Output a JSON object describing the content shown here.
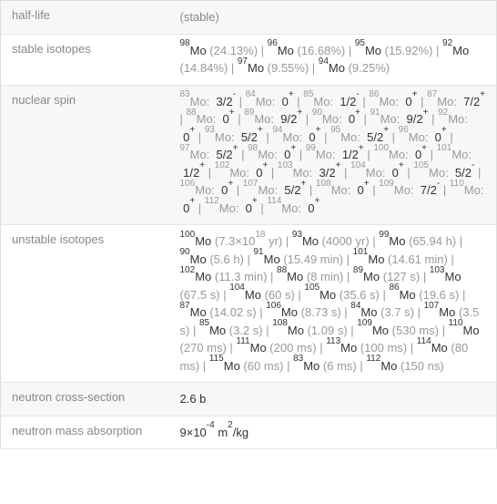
{
  "rows": [
    {
      "label": "half-life",
      "value": "(stable)",
      "type": "plain-grey"
    },
    {
      "label": "stable isotopes",
      "type": "iso-abundance",
      "items": [
        {
          "sup": "98",
          "el": "Mo",
          "abund": "(24.13%)"
        },
        {
          "sup": "96",
          "el": "Mo",
          "abund": "(16.68%)"
        },
        {
          "sup": "95",
          "el": "Mo",
          "abund": "(15.92%)"
        },
        {
          "sup": "92",
          "el": "Mo",
          "abund": "(14.84%)"
        },
        {
          "sup": "97",
          "el": "Mo",
          "abund": "(9.55%)"
        },
        {
          "sup": "94",
          "el": "Mo",
          "abund": "(9.25%)"
        }
      ]
    },
    {
      "label": "nuclear spin",
      "type": "nuclear-spin",
      "items": [
        {
          "sup": "83",
          "el": "Mo",
          "spin": "3/2",
          "sign": "-"
        },
        {
          "sup": "84",
          "el": "Mo",
          "spin": "0",
          "sign": "+"
        },
        {
          "sup": "85",
          "el": "Mo",
          "spin": "1/2",
          "sign": "-"
        },
        {
          "sup": "86",
          "el": "Mo",
          "spin": "0",
          "sign": "+"
        },
        {
          "sup": "87",
          "el": "Mo",
          "spin": "7/2",
          "sign": "+"
        },
        {
          "sup": "88",
          "el": "Mo",
          "spin": "0",
          "sign": "+"
        },
        {
          "sup": "89",
          "el": "Mo",
          "spin": "9/2",
          "sign": "+"
        },
        {
          "sup": "90",
          "el": "Mo",
          "spin": "0",
          "sign": "+"
        },
        {
          "sup": "91",
          "el": "Mo",
          "spin": "9/2",
          "sign": "+"
        },
        {
          "sup": "92",
          "el": "Mo",
          "spin": "0",
          "sign": "+"
        },
        {
          "sup": "93",
          "el": "Mo",
          "spin": "5/2",
          "sign": "+"
        },
        {
          "sup": "94",
          "el": "Mo",
          "spin": "0",
          "sign": "+"
        },
        {
          "sup": "95",
          "el": "Mo",
          "spin": "5/2",
          "sign": "+"
        },
        {
          "sup": "96",
          "el": "Mo",
          "spin": "0",
          "sign": "+"
        },
        {
          "sup": "97",
          "el": "Mo",
          "spin": "5/2",
          "sign": "+"
        },
        {
          "sup": "98",
          "el": "Mo",
          "spin": "0",
          "sign": "+"
        },
        {
          "sup": "99",
          "el": "Mo",
          "spin": "1/2",
          "sign": "+"
        },
        {
          "sup": "100",
          "el": "Mo",
          "spin": "0",
          "sign": "+"
        },
        {
          "sup": "101",
          "el": "Mo",
          "spin": "1/2",
          "sign": "+"
        },
        {
          "sup": "102",
          "el": "Mo",
          "spin": "0",
          "sign": "+"
        },
        {
          "sup": "103",
          "el": "Mo",
          "spin": "3/2",
          "sign": "+"
        },
        {
          "sup": "104",
          "el": "Mo",
          "spin": "0",
          "sign": "+"
        },
        {
          "sup": "105",
          "el": "Mo",
          "spin": "5/2",
          "sign": "-"
        },
        {
          "sup": "106",
          "el": "Mo",
          "spin": "0",
          "sign": "+"
        },
        {
          "sup": "107",
          "el": "Mo",
          "spin": "5/2",
          "sign": "+"
        },
        {
          "sup": "108",
          "el": "Mo",
          "spin": "0",
          "sign": "+"
        },
        {
          "sup": "109",
          "el": "Mo",
          "spin": "7/2",
          "sign": "-"
        },
        {
          "sup": "110",
          "el": "Mo",
          "spin": "0",
          "sign": "+"
        },
        {
          "sup": "112",
          "el": "Mo",
          "spin": "0",
          "sign": "+"
        },
        {
          "sup": "114",
          "el": "Mo",
          "spin": "0",
          "sign": "+"
        }
      ]
    },
    {
      "label": "unstable isotopes",
      "type": "unstable",
      "items": [
        {
          "sup": "100",
          "el": "Mo",
          "hl_html": "(7.3×10<sup>18</sup> yr)"
        },
        {
          "sup": "93",
          "el": "Mo",
          "hl_html": "(4000 yr)"
        },
        {
          "sup": "99",
          "el": "Mo",
          "hl_html": "(65.94 h)"
        },
        {
          "sup": "90",
          "el": "Mo",
          "hl_html": "(5.6 h)"
        },
        {
          "sup": "91",
          "el": "Mo",
          "hl_html": "(15.49 min)"
        },
        {
          "sup": "101",
          "el": "Mo",
          "hl_html": "(14.61 min)"
        },
        {
          "sup": "102",
          "el": "Mo",
          "hl_html": "(11.3 min)"
        },
        {
          "sup": "88",
          "el": "Mo",
          "hl_html": "(8 min)"
        },
        {
          "sup": "89",
          "el": "Mo",
          "hl_html": "(127 s)"
        },
        {
          "sup": "103",
          "el": "Mo",
          "hl_html": "(67.5 s)"
        },
        {
          "sup": "104",
          "el": "Mo",
          "hl_html": "(60 s)"
        },
        {
          "sup": "105",
          "el": "Mo",
          "hl_html": "(35.6 s)"
        },
        {
          "sup": "86",
          "el": "Mo",
          "hl_html": "(19.6 s)"
        },
        {
          "sup": "87",
          "el": "Mo",
          "hl_html": "(14.02 s)"
        },
        {
          "sup": "106",
          "el": "Mo",
          "hl_html": "(8.73 s)"
        },
        {
          "sup": "84",
          "el": "Mo",
          "hl_html": "(3.7 s)"
        },
        {
          "sup": "107",
          "el": "Mo",
          "hl_html": "(3.5 s)"
        },
        {
          "sup": "85",
          "el": "Mo",
          "hl_html": "(3.2 s)"
        },
        {
          "sup": "108",
          "el": "Mo",
          "hl_html": "(1.09 s)"
        },
        {
          "sup": "109",
          "el": "Mo",
          "hl_html": "(530 ms)"
        },
        {
          "sup": "110",
          "el": "Mo",
          "hl_html": "(270 ms)"
        },
        {
          "sup": "111",
          "el": "Mo",
          "hl_html": "(200 ms)"
        },
        {
          "sup": "113",
          "el": "Mo",
          "hl_html": "(100 ms)"
        },
        {
          "sup": "114",
          "el": "Mo",
          "hl_html": "(80 ms)"
        },
        {
          "sup": "115",
          "el": "Mo",
          "hl_html": "(60 ms)"
        },
        {
          "sup": "83",
          "el": "Mo",
          "hl_html": "(6 ms)"
        },
        {
          "sup": "112",
          "el": "Mo",
          "hl_html": "(150 ns)"
        }
      ]
    },
    {
      "label": "neutron cross-section",
      "value": "2.6 b",
      "type": "plain"
    },
    {
      "label": "neutron mass absorption",
      "value_html": "9×10<sup>-4</sup> m<sup>2</sup>/kg",
      "type": "plain-html"
    }
  ],
  "separator": " | "
}
